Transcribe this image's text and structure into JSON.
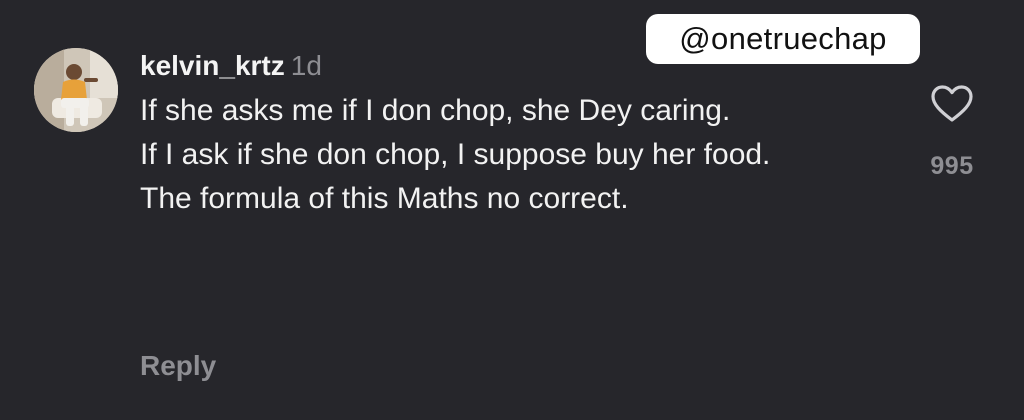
{
  "watermark": {
    "text": "@onetruechap"
  },
  "comment": {
    "avatar_icon": "user-avatar-photo",
    "username": "kelvin_krtz",
    "timestamp": "1d",
    "paragraphs": [
      "If she asks me if I don chop, she Dey caring.",
      "If I ask if she don chop, I suppose buy her food.",
      "The formula of this Maths no correct."
    ],
    "reply_label": "Reply",
    "like": {
      "icon": "heart-outline-icon",
      "count": "995"
    }
  },
  "colors": {
    "background": "#26262b",
    "text_primary": "#f2f2f2",
    "text_secondary": "#8e8e93",
    "watermark_bg": "#ffffff"
  }
}
